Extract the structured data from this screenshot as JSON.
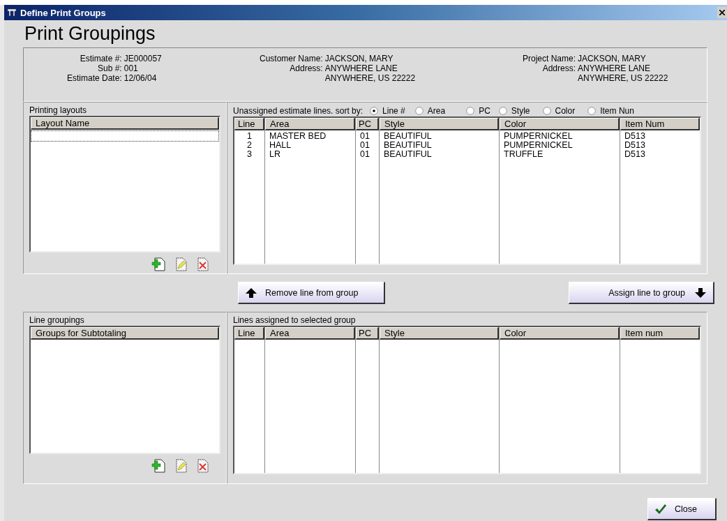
{
  "window": {
    "title": "Define Print Groups"
  },
  "heading": "Print Groupings",
  "estimate_info": {
    "columns": [
      {
        "fields": [
          {
            "label": "Estimate #:",
            "value": "JE000057"
          },
          {
            "label": "Sub #:",
            "value": "001"
          },
          {
            "label": "Estimate Date:",
            "value": "12/06/04"
          }
        ]
      },
      {
        "fields": [
          {
            "label": "Customer Name:",
            "value": "JACKSON, MARY"
          },
          {
            "label": "Address:",
            "value": "ANYWHERE LANE"
          },
          {
            "value": "ANYWHERE, US 22222"
          }
        ]
      },
      {
        "fields": [
          {
            "label": "Project Name:",
            "value": "JACKSON, MARY"
          },
          {
            "label": "Address:",
            "value": "ANYWHERE LANE"
          },
          {
            "value": "ANYWHERE, US 22222"
          }
        ]
      }
    ]
  },
  "printing_layouts": {
    "title": "Printing layouts",
    "column": "Layout Name",
    "rows": [
      {
        "focused": true
      }
    ]
  },
  "unassigned": {
    "title": "Unassigned estimate lines. sort by:",
    "sort_options": [
      {
        "label": "Line #",
        "selected": true
      },
      {
        "label": "Area",
        "selected": false
      },
      {
        "label": "PC",
        "selected": false
      },
      {
        "label": "Style",
        "selected": false
      },
      {
        "label": "Color",
        "selected": false
      },
      {
        "label": "Item Nun",
        "selected": false
      }
    ],
    "columns": [
      "Line",
      "Area",
      "PC",
      "Style",
      "Color",
      "Item Num"
    ],
    "rows": [
      [
        "1",
        "MASTER BED",
        "01",
        "BEAUTIFUL",
        "PUMPERNICKEL",
        "D513"
      ],
      [
        "2",
        "HALL",
        "01",
        "BEAUTIFUL",
        "PUMPERNICKEL",
        "D513"
      ],
      [
        "3",
        "LR",
        "01",
        "BEAUTIFUL",
        "TRUFFLE",
        "D513"
      ]
    ]
  },
  "buttons": {
    "remove": "Remove line from group",
    "assign": "Assign line to group",
    "close": "Close"
  },
  "line_groupings": {
    "title": "Line groupings",
    "column": "Groups for Subtotaling"
  },
  "assigned": {
    "title": "Lines assigned to selected group",
    "columns": [
      "Line",
      "Area",
      "PC",
      "Style",
      "Color",
      "Item num"
    ]
  }
}
